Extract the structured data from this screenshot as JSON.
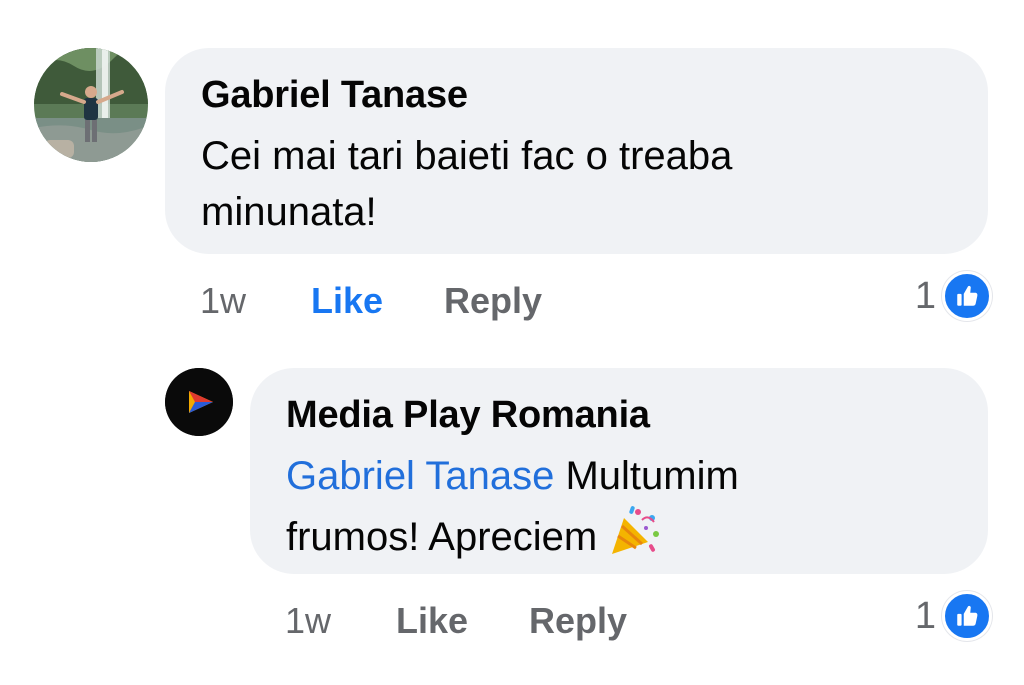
{
  "comments": [
    {
      "author": "Gabriel Tanase",
      "text": "Cei mai tari baieti fac o treaba minunata!",
      "time": "1w",
      "like_label": "Like",
      "reply_label": "Reply",
      "reaction_count": "1",
      "reaction_icon": "thumbs-up-icon",
      "liked_by_viewer": true
    },
    {
      "author": "Media Play Romania",
      "mention": "Gabriel Tanase",
      "text": "Multumim frumos! Apreciem",
      "emoji": "party-popper-icon",
      "time": "1w",
      "like_label": "Like",
      "reply_label": "Reply",
      "reaction_count": "1",
      "reaction_icon": "thumbs-up-icon",
      "liked_by_viewer": false
    }
  ],
  "colors": {
    "bubble": "#f0f2f5",
    "mention": "#216fdb",
    "like_active": "#1877f2",
    "meta_text": "#65676b",
    "reaction_badge": "#1877f2"
  }
}
